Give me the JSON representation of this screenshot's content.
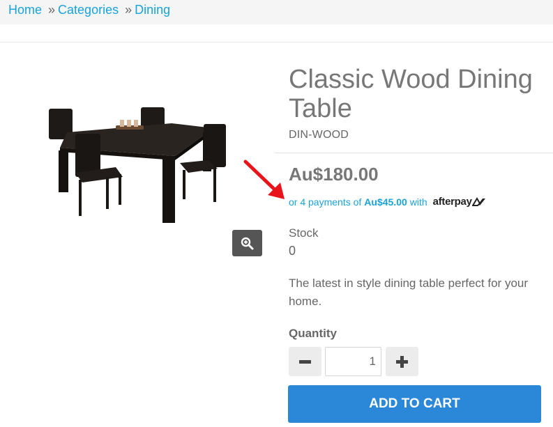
{
  "breadcrumb": {
    "items": [
      "Home",
      "Categories",
      "Dining"
    ],
    "separator": "»"
  },
  "product": {
    "title": "Classic Wood Dining Table",
    "sku": "DIN-WOOD",
    "price": "Au$180.00",
    "image_alt": "dining-table-with-chairs"
  },
  "afterpay": {
    "prefix": "or 4 payments of",
    "amount": "Au$45.00",
    "suffix": "with",
    "logo_text": "afterpay"
  },
  "stock": {
    "label": "Stock",
    "value": "0"
  },
  "description": "The latest in style dining table perfect for your home.",
  "quantity": {
    "label": "Quantity",
    "value": "1"
  },
  "cart": {
    "add_label": "ADD TO CART"
  },
  "icons": {
    "zoom": "zoom-in-icon",
    "minus": "minus-icon",
    "plus": "plus-icon",
    "annotation": "red-arrow"
  },
  "colors": {
    "link": "#1aa3d8",
    "button": "#2b88d8",
    "zoom_bg": "#555555",
    "annotation_arrow": "#e8141a"
  }
}
